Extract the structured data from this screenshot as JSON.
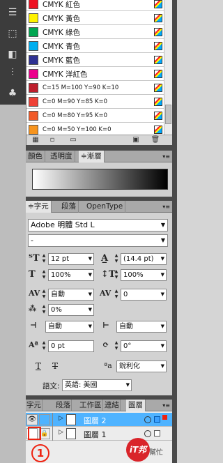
{
  "tools": {
    "icons": [
      "hand-with-bars-icon",
      "selection-frame-icon",
      "pathfinder-icon",
      "align-icon",
      "club-symbol-icon"
    ]
  },
  "swatches": {
    "items": [
      {
        "name": "CMYK 紅色",
        "color": "#ee1122"
      },
      {
        "name": "CMYK 黃色",
        "color": "#fff200"
      },
      {
        "name": "CMYK 綠色",
        "color": "#00a650"
      },
      {
        "name": "CMYK 青色",
        "color": "#00aeef"
      },
      {
        "name": "CMYK 藍色",
        "color": "#2e3192"
      },
      {
        "name": "CMYK 洋紅色",
        "color": "#ec008c"
      },
      {
        "name": "C=15 M=100 Y=90 K=10",
        "color": "#be1e2d"
      },
      {
        "name": "C=0 M=90 Y=85 K=0",
        "color": "#ef4136"
      },
      {
        "name": "C=0 M=80 Y=95 K=0",
        "color": "#f15a29"
      },
      {
        "name": "C=0 M=50 Y=100 K=0",
        "color": "#f7941d"
      }
    ]
  },
  "gradient_panel": {
    "tabs": [
      "顏色",
      "透明度",
      "≑漸層"
    ]
  },
  "character_panel": {
    "tabs": [
      "≑字元",
      "段落",
      "OpenType"
    ],
    "font_family": "Adobe 明體 Std L",
    "font_style": "-",
    "size": "12 pt",
    "leading": "(14.4 pt)",
    "vertical_scale": "100%",
    "horizontal_scale": "100%",
    "kerning": "自動",
    "tracking": "0",
    "tsume": "0%",
    "aki_before": "自動",
    "aki_after": "自動",
    "baseline_shift": "0 pt",
    "rotation": "0°",
    "antialias": "銳利化",
    "language_label": "語文:",
    "language": "英語: 美國"
  },
  "layers_panel": {
    "tabs": [
      "字元",
      "段落",
      "工作區",
      "連結",
      "圖層"
    ],
    "layers": [
      {
        "name": "圖層 2",
        "selected": true
      },
      {
        "name": "圖層 1",
        "selected": false
      }
    ]
  },
  "callout": {
    "number": "1"
  },
  "watermark": {
    "logo": "iT邦",
    "text": "幫忙"
  }
}
